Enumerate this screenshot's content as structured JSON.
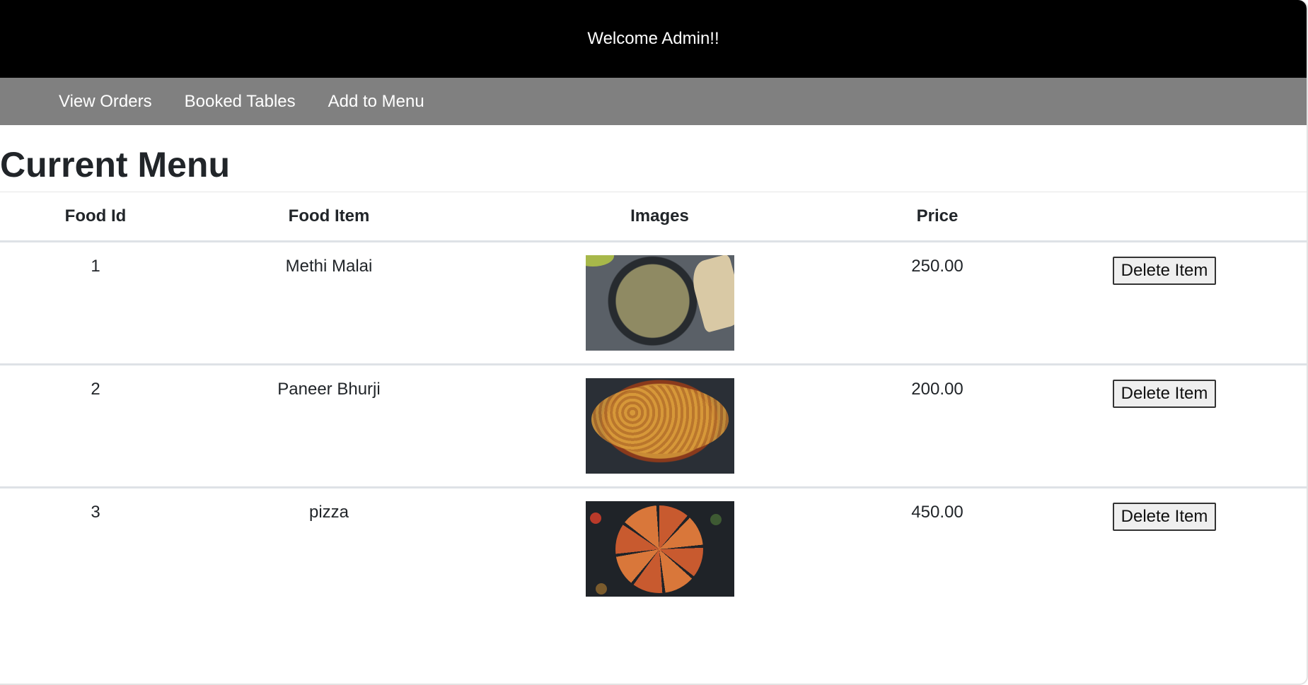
{
  "header": {
    "welcome": "Welcome Admin!!"
  },
  "nav": {
    "items": [
      {
        "label": "View Orders"
      },
      {
        "label": "Booked Tables"
      },
      {
        "label": "Add to Menu"
      }
    ]
  },
  "page": {
    "title": "Current Menu"
  },
  "table": {
    "headers": {
      "food_id": "Food Id",
      "food_item": "Food Item",
      "images": "Images",
      "price": "Price",
      "action": ""
    },
    "rows": [
      {
        "id": "1",
        "name": "Methi Malai",
        "price": "250.00",
        "action": "Delete Item"
      },
      {
        "id": "2",
        "name": "Paneer Bhurji",
        "price": "200.00",
        "action": "Delete Item"
      },
      {
        "id": "3",
        "name": "pizza",
        "price": "450.00",
        "action": "Delete Item"
      }
    ]
  }
}
